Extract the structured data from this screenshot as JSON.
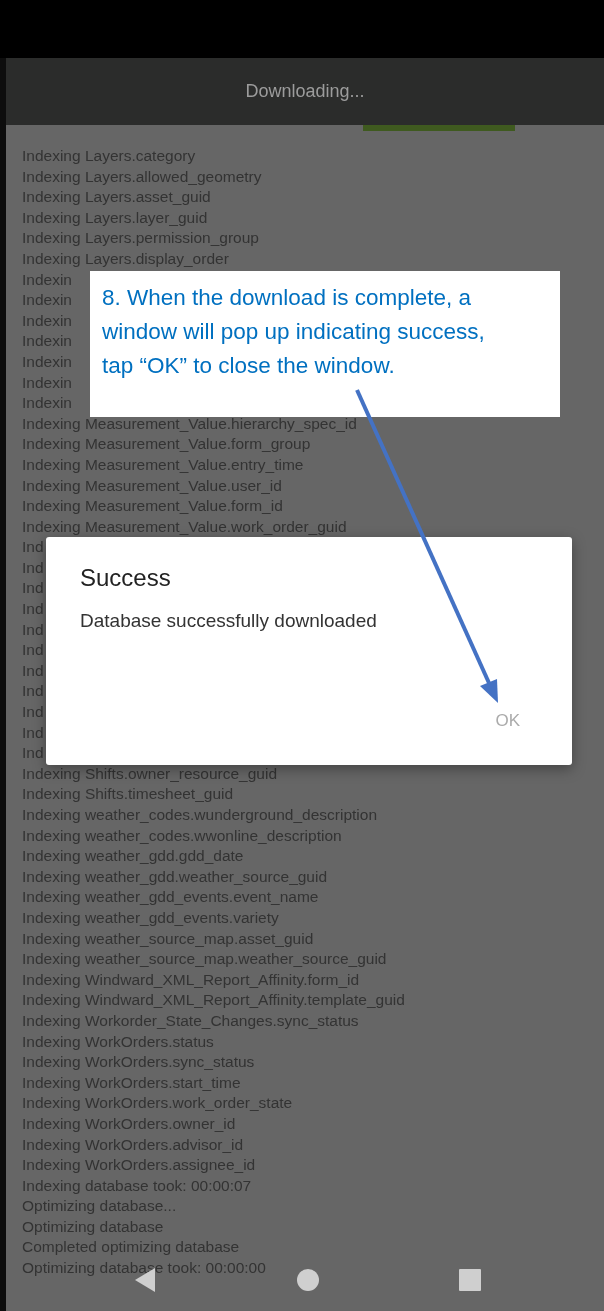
{
  "header": {
    "title": "Downloading..."
  },
  "log_lines": [
    "Indexing Layers.category",
    "Indexing Layers.allowed_geometry",
    "Indexing Layers.asset_guid",
    "Indexing Layers.layer_guid",
    "Indexing Layers.permission_group",
    "Indexing Layers.display_order",
    "Indexin",
    "Indexin",
    "Indexin",
    "Indexin",
    "Indexin",
    "Indexin",
    "Indexin",
    "Indexing Measurement_Value.hierarchy_spec_id",
    "Indexing Measurement_Value.form_group",
    "Indexing Measurement_Value.entry_time",
    "Indexing Measurement_Value.user_id",
    "Indexing Measurement_Value.form_id",
    "Indexing Measurement_Value.work_order_guid",
    "Ind",
    "Ind",
    "Ind",
    "Ind",
    "Ind",
    "Ind",
    "Ind",
    "Ind",
    "Ind",
    "Ind",
    "Ind",
    "Indexing Shifts.owner_resource_guid",
    "Indexing Shifts.timesheet_guid",
    "Indexing weather_codes.wunderground_description",
    "Indexing weather_codes.wwonline_description",
    "Indexing weather_gdd.gdd_date",
    "Indexing weather_gdd.weather_source_guid",
    "Indexing weather_gdd_events.event_name",
    "Indexing weather_gdd_events.variety",
    "Indexing weather_source_map.asset_guid",
    "Indexing weather_source_map.weather_source_guid",
    "Indexing Windward_XML_Report_Affinity.form_id",
    "Indexing Windward_XML_Report_Affinity.template_guid",
    "Indexing Workorder_State_Changes.sync_status",
    "Indexing WorkOrders.status",
    "Indexing WorkOrders.sync_status",
    "Indexing WorkOrders.start_time",
    "Indexing WorkOrders.work_order_state",
    "Indexing WorkOrders.owner_id",
    "Indexing WorkOrders.advisor_id",
    "Indexing WorkOrders.assignee_id",
    "Indexing database took: 00:00:07",
    "Optimizing database...",
    "Optimizing database",
    "Completed optimizing database",
    "Optimizing database took: 00:00:00"
  ],
  "callout": {
    "text": "8. When the download is complete, a window will pop up indicating success, tap “OK” to close the window."
  },
  "dialog": {
    "title": "Success",
    "message": "Database successfully downloaded",
    "button": "OK"
  }
}
